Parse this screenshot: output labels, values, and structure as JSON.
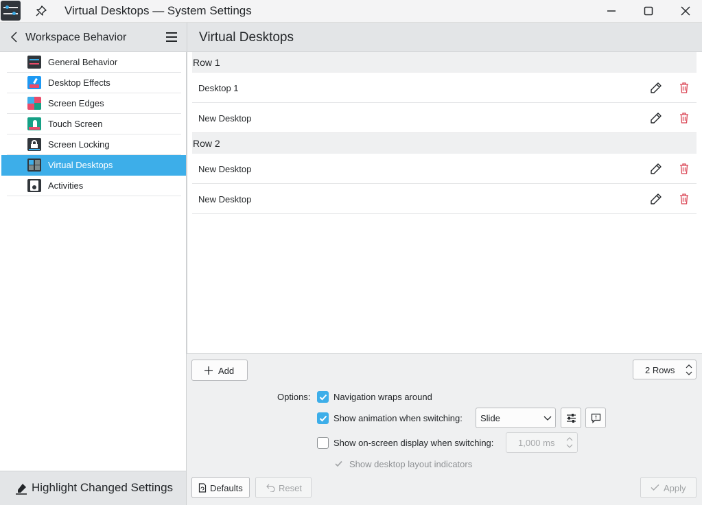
{
  "window": {
    "title": "Virtual Desktops — System Settings"
  },
  "sidebar": {
    "title": "Workspace Behavior",
    "items": [
      {
        "label": "General Behavior",
        "icon": "general-behavior-icon"
      },
      {
        "label": "Desktop Effects",
        "icon": "desktop-effects-icon"
      },
      {
        "label": "Screen Edges",
        "icon": "screen-edges-icon"
      },
      {
        "label": "Touch Screen",
        "icon": "touch-screen-icon"
      },
      {
        "label": "Screen Locking",
        "icon": "screen-locking-icon"
      },
      {
        "label": "Virtual Desktops",
        "icon": "virtual-desktops-icon",
        "active": true
      },
      {
        "label": "Activities",
        "icon": "activities-icon"
      }
    ],
    "highlight_label": "Highlight Changed Settings"
  },
  "page": {
    "title": "Virtual Desktops",
    "rows": [
      {
        "label": "Row 1",
        "desktops": [
          "Desktop 1",
          "New Desktop"
        ]
      },
      {
        "label": "Row 2",
        "desktops": [
          "New Desktop",
          "New Desktop"
        ]
      }
    ],
    "add_label": "Add",
    "rows_value": "2 Rows",
    "options_label": "Options:",
    "nav_wraps_label": "Navigation wraps around",
    "nav_wraps_checked": true,
    "show_animation_label": "Show animation when switching:",
    "show_animation_checked": true,
    "animation_value": "Slide",
    "show_osd_label": "Show on-screen display when switching:",
    "show_osd_checked": false,
    "osd_duration": "1,000 ms",
    "layout_indicators_label": "Show desktop layout indicators",
    "layout_indicators_checked": true
  },
  "footer": {
    "defaults_label": "Defaults",
    "reset_label": "Reset",
    "apply_label": "Apply"
  },
  "colors": {
    "accent": "#3daee9",
    "delete": "#da4453"
  }
}
